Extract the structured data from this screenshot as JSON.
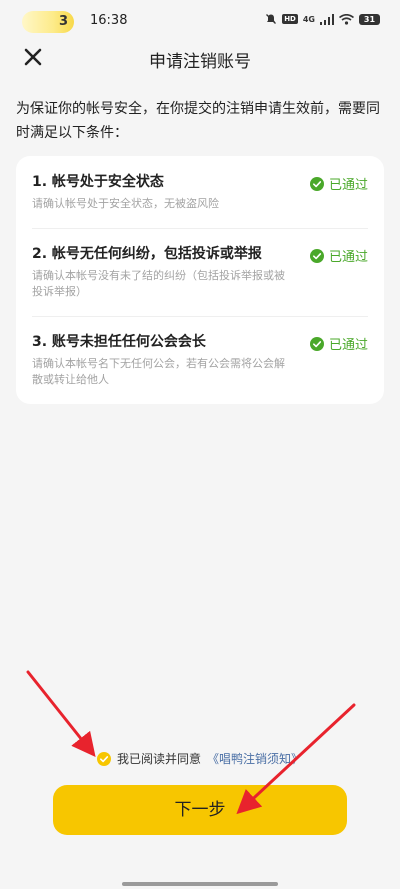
{
  "status_bar": {
    "pill_number": "3",
    "time": "16:38",
    "hd_label": "HD",
    "network_label": "4G",
    "battery": "31"
  },
  "header": {
    "title": "申请注销账号"
  },
  "intro": "为保证你的帐号安全，在你提交的注销申请生效前，需要同时满足以下条件：",
  "conditions": [
    {
      "title": "1. 帐号处于安全状态",
      "desc": "请确认帐号处于安全状态，无被盗风险",
      "status": "已通过"
    },
    {
      "title": "2. 帐号无任何纠纷，包括投诉或举报",
      "desc": "请确认本帐号没有未了结的纠纷（包括投诉举报或被投诉举报）",
      "status": "已通过"
    },
    {
      "title": "3. 账号未担任任何公会会长",
      "desc": "请确认本帐号名下无任何公会，若有公会需将公会解散或转让给他人",
      "status": "已通过"
    }
  ],
  "agreement": {
    "text": "我已阅读并同意",
    "link": "《唱鸭注销须知》"
  },
  "next_button": "下一步",
  "colors": {
    "accent": "#f7c600",
    "status_green": "#4aa82a",
    "link": "#4a6fa5",
    "annotation_arrow": "#e8232d"
  }
}
